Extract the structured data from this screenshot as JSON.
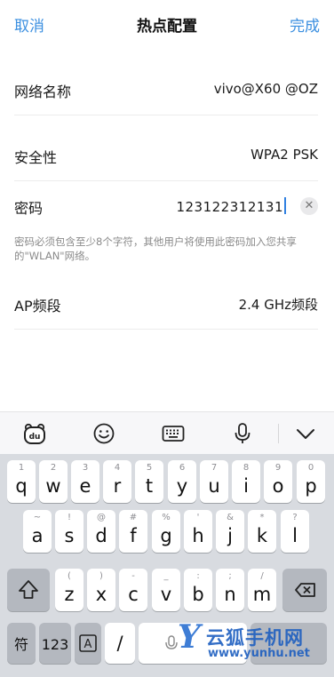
{
  "header": {
    "cancel_label": "取消",
    "title": "热点配置",
    "done_label": "完成"
  },
  "form": {
    "name_label": "网络名称",
    "name_value": "vivo@X60 @OZ",
    "security_label": "安全性",
    "security_value": "WPA2 PSK",
    "password_label": "密码",
    "password_value": "123122312131",
    "password_hint": "密码必须包含至少8个字符，其他用户将使用此密码加入您共享的\"WLAN\"网络。",
    "ap_band_label": "AP频段",
    "ap_band_value": "2.4 GHz频段"
  },
  "toolbar": {
    "icons": [
      "du-logo-icon",
      "emoji-icon",
      "keyboard-icon",
      "microphone-icon",
      "chevron-down-icon"
    ]
  },
  "keyboard": {
    "row1": [
      {
        "hint": "1",
        "main": "q"
      },
      {
        "hint": "2",
        "main": "w"
      },
      {
        "hint": "3",
        "main": "e"
      },
      {
        "hint": "4",
        "main": "r"
      },
      {
        "hint": "5",
        "main": "t"
      },
      {
        "hint": "6",
        "main": "y"
      },
      {
        "hint": "7",
        "main": "u"
      },
      {
        "hint": "8",
        "main": "i"
      },
      {
        "hint": "9",
        "main": "o"
      },
      {
        "hint": "0",
        "main": "p"
      }
    ],
    "row2": [
      {
        "hint": "~",
        "main": "a"
      },
      {
        "hint": "!",
        "main": "s"
      },
      {
        "hint": "@",
        "main": "d"
      },
      {
        "hint": "#",
        "main": "f"
      },
      {
        "hint": "%",
        "main": "g"
      },
      {
        "hint": "'",
        "main": "h"
      },
      {
        "hint": "&",
        "main": "j"
      },
      {
        "hint": "*",
        "main": "k"
      },
      {
        "hint": "?",
        "main": "l"
      }
    ],
    "row3": [
      {
        "hint": "(",
        "main": "z"
      },
      {
        "hint": ")",
        "main": "x"
      },
      {
        "hint": "-",
        "main": "c"
      },
      {
        "hint": "_",
        "main": "v"
      },
      {
        "hint": ":",
        "main": "b"
      },
      {
        "hint": ";",
        "main": "n"
      },
      {
        "hint": "/",
        "main": "m"
      }
    ],
    "symbol_label": "符",
    "num_label": "123",
    "slash_label": "/"
  },
  "watermark": {
    "brand": "云狐手机网",
    "url": "www.yunhu.net"
  },
  "colors": {
    "accent": "#3b8fe0",
    "keyboard_bg": "#d8dbe0",
    "watermark": "#1e5fc0"
  }
}
